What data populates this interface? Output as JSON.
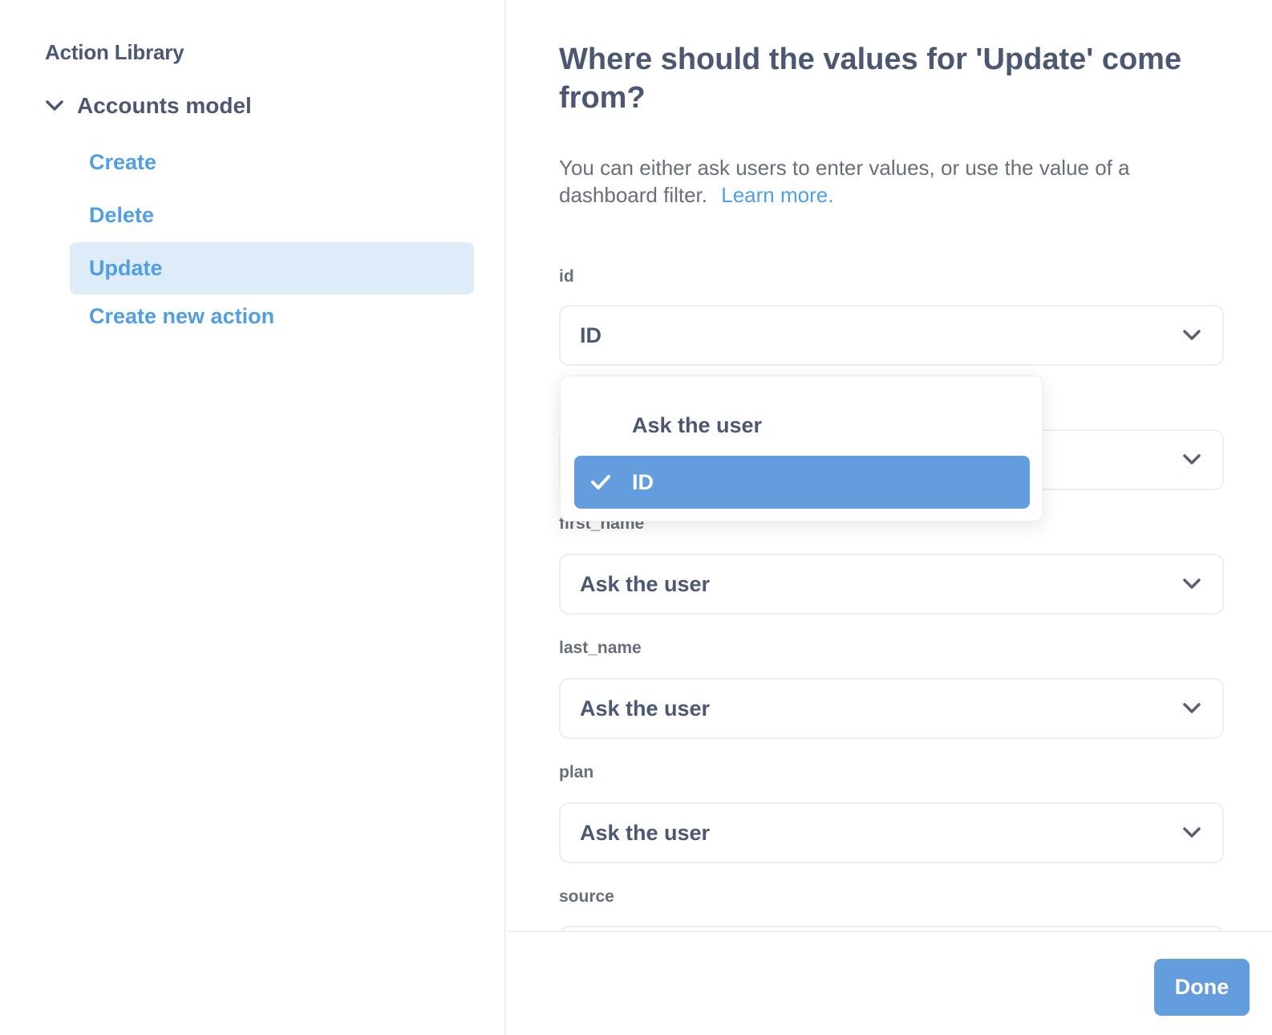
{
  "sidebar": {
    "title": "Action Library",
    "model": {
      "label": "Accounts model",
      "expanded": true,
      "icon": "chevron-down-icon"
    },
    "actions": [
      {
        "label": "Create",
        "active": false
      },
      {
        "label": "Delete",
        "active": false
      },
      {
        "label": "Update",
        "active": true
      },
      {
        "label": "Create new action",
        "active": false
      }
    ]
  },
  "main": {
    "heading": "Where should the values for 'Update' come from?",
    "description": "You can either ask users to enter values, or use the value of a dashboard filter.",
    "learn_more": "Learn more.",
    "fields": [
      {
        "label": "id",
        "value": "ID"
      },
      {
        "label": "",
        "value": ""
      },
      {
        "label": "first_name",
        "value": "Ask the user"
      },
      {
        "label": "last_name",
        "value": "Ask the user"
      },
      {
        "label": "plan",
        "value": "Ask the user"
      },
      {
        "label": "source",
        "value": ""
      }
    ],
    "dropdown": {
      "options": [
        {
          "label": "Ask the user",
          "selected": false
        },
        {
          "label": "ID",
          "selected": true,
          "icon": "check-icon"
        }
      ]
    }
  },
  "footer": {
    "done_label": "Done"
  },
  "colors": {
    "accent": "#509ee3",
    "button": "#649dde",
    "active_bg": "#deebf8",
    "text_dark": "#4c5773",
    "text_muted": "#696e7b",
    "border": "#eeeeef"
  }
}
